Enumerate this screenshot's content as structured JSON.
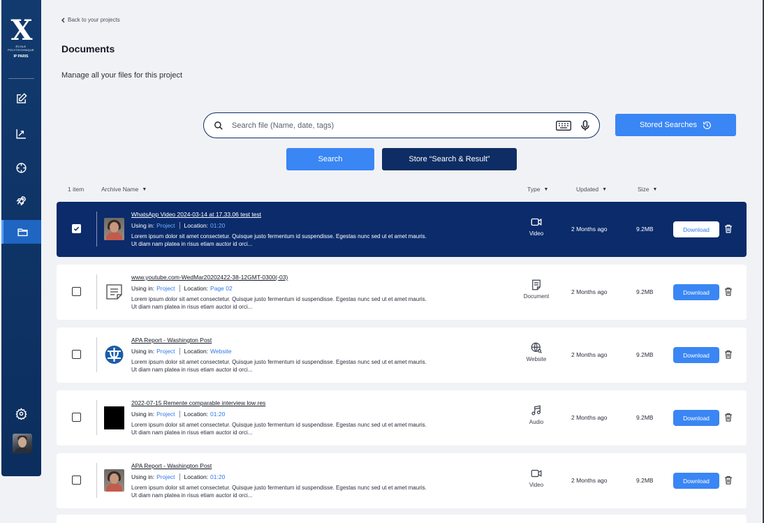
{
  "header": {
    "back_label": "Back to your projects",
    "title": "Documents",
    "subtitle": "Manage all your files for this project"
  },
  "logo": {
    "mark": "X",
    "line1": "ÉCOLE",
    "line2": "POLYTECHNIQUE",
    "line3": "IP PARIS"
  },
  "search": {
    "placeholder": "Search file (Name, date, tags)",
    "value": "",
    "stored_label": "Stored Searches",
    "search_label": "Search",
    "store_label": "Store “Search & Result”"
  },
  "table": {
    "count": "1 item",
    "col_name": "Archive Name",
    "col_type": "Type",
    "col_updated": "Updated",
    "col_size": "Size"
  },
  "rows": [
    {
      "name": "WhatsApp Video 2024-03-14 at 17.33.06 test test",
      "using_label": "Using in:",
      "using": "Project",
      "location_label": "Location:",
      "location": "01:20",
      "desc": "Lorem ipsum dolor sit amet consectetur. Quisque justo fermentum id suspendisse. Egestas nunc sed ut et amet mauris. Ut diam nam platea in risus etiam auctor id orci...",
      "type": "Video",
      "updated": "2 Months ago",
      "size": "9.2MB",
      "download": "Download"
    },
    {
      "name": "www.youtube.com-WedMar20202422-38-12GMT-0300(-03)",
      "using_label": "Using in:",
      "using": "Project",
      "location_label": "Location:",
      "location": "Page 02",
      "desc": "Lorem ipsum dolor sit amet consectetur. Quisque justo fermentum id suspendisse. Egestas nunc sed ut et amet mauris. Ut diam nam platea in risus etiam auctor id orci...",
      "type": "Document",
      "updated": "2 Months ago",
      "size": "9.2MB",
      "download": "Download"
    },
    {
      "name": "APA Report - Washington Post",
      "using_label": "Using in:",
      "using": "Project",
      "location_label": "Location:",
      "location": "Website",
      "desc": "Lorem ipsum dolor sit amet consectetur. Quisque justo fermentum id suspendisse. Egestas nunc sed ut et amet mauris. Ut diam nam platea in risus etiam auctor id orci...",
      "type": "Website",
      "updated": "2 Months ago",
      "size": "9.2MB",
      "download": "Download"
    },
    {
      "name": "2022-07-15 Remente comparable interview low res",
      "using_label": "Using in:",
      "using": "Project",
      "location_label": "Location:",
      "location": "01:20",
      "desc": "Lorem ipsum dolor sit amet consectetur. Quisque justo fermentum id suspendisse. Egestas nunc sed ut et amet mauris. Ut diam nam platea in risus etiam auctor id orci...",
      "type": "Audio",
      "updated": "2 Months ago",
      "size": "9.2MB",
      "download": "Download"
    },
    {
      "name": "APA Report - Washington Post",
      "using_label": "Using in:",
      "using": "Project",
      "location_label": "Location:",
      "location": "01:20",
      "desc": "Lorem ipsum dolor sit amet consectetur. Quisque justo fermentum id suspendisse. Egestas nunc sed ut et amet mauris. Ut diam nam platea in risus etiam auctor id orci...",
      "type": "Video",
      "updated": "2 Months ago",
      "size": "9.2MB",
      "download": "Download"
    }
  ],
  "colors": {
    "sidebar": "#0b2e5e",
    "primary": "#3a86f4",
    "navy": "#0e2d64",
    "selected_row": "#0b2b6b",
    "link": "#2e78e8"
  }
}
